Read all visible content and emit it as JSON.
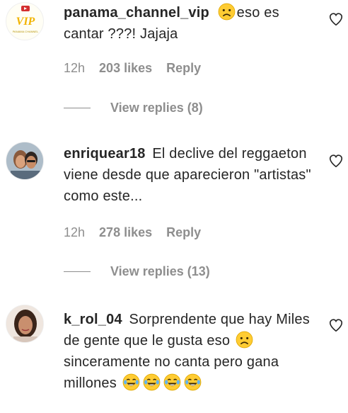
{
  "comments": [
    {
      "username": "panama_channel_vip",
      "text_before_emoji": "",
      "emoji1": "sad-face",
      "text_after_emoji": "eso es cantar ???! Jajaja",
      "time": "12h",
      "likes": "203 likes",
      "reply": "Reply",
      "view_replies": "View replies (8)",
      "avatar_logo": "VIP",
      "avatar_logo_sub": "PANAMA CHANNEL"
    },
    {
      "username": "enriquear18",
      "text": "El declive del reggaeton viene desde que aparecieron \"artistas\" como este...",
      "time": "12h",
      "likes": "278 likes",
      "reply": "Reply",
      "view_replies": "View replies (13)"
    },
    {
      "username": "k_rol_04",
      "text_part1": "Sorprendente que hay Miles de gente que le gusta eso",
      "emoji_mid": "sad-face",
      "text_part2": "sinceramente no canta pero gana millones",
      "emoji_end": [
        "laughing-tears-face",
        "laughing-tears-face",
        "laughing-tears-face",
        "laughing-tears-face"
      ]
    }
  ],
  "colors": {
    "text": "#262626",
    "secondary": "#8e8e8e",
    "emoji_yellow": "#ffcc33"
  }
}
